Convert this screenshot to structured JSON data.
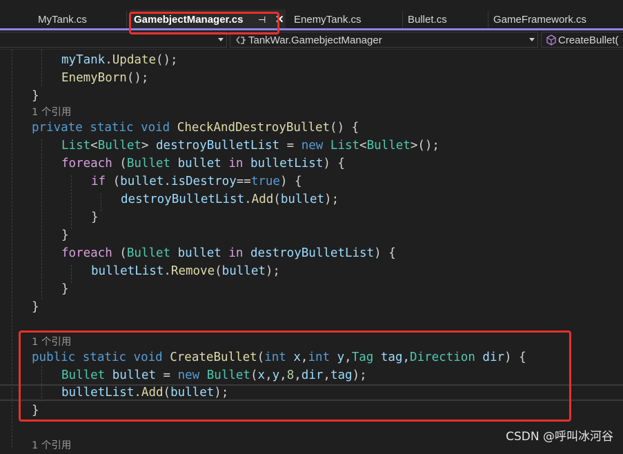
{
  "tabs": [
    {
      "label": "MyTank.cs"
    },
    {
      "label": "GamebjectManager.cs",
      "active": true
    },
    {
      "label": "EnemyTank.cs"
    },
    {
      "label": "Bullet.cs"
    },
    {
      "label": "GameFramework.cs"
    }
  ],
  "tab_pin_glyph": "⊣",
  "tab_close_glyph": "✕",
  "nav": {
    "class_selector": "TankWar.GamebjectManager",
    "member_selector": "CreateBullet("
  },
  "code": {
    "l1_obj": "myTank",
    "l1_fn": "Update",
    "l2_fn": "EnemyBorn",
    "ref_label_1": "1 个引用",
    "ref_label_2": "1 个引用",
    "ref_label_3": "1 个引用",
    "m1_kw1": "private",
    "m1_kw2": "static",
    "m1_kw3": "void",
    "m1_name": "CheckAndDestroyBullet",
    "list_type": "List",
    "bullet_type": "Bullet",
    "destroy_var": "destroyBulletList",
    "new_kw": "new",
    "foreach_kw": "foreach",
    "in_kw": "in",
    "if_kw": "if",
    "bullet_var": "bullet",
    "bullet_list": "bulletList",
    "is_destroy": "isDestroy",
    "true_kw": "true",
    "add_fn": "Add",
    "remove_fn": "Remove",
    "m2_kw1": "public",
    "m2_kw2": "static",
    "m2_kw3": "void",
    "m2_name": "CreateBullet",
    "int_kw": "int",
    "p_x": "x",
    "p_y": "y",
    "tag_type": "Tag",
    "p_tag": "tag",
    "dir_type": "Direction",
    "p_dir": "dir",
    "num_8": "8"
  },
  "watermark": "CSDN @呼叫冰河谷",
  "colors": {
    "accent": "#9184ee",
    "highlight_box": "#e8312b",
    "keyword": "#569cd6",
    "control_keyword": "#d8a0df",
    "type": "#4ec9b0",
    "method": "#dcdcaa",
    "variable": "#9cdcfe",
    "number": "#b5cea8"
  }
}
